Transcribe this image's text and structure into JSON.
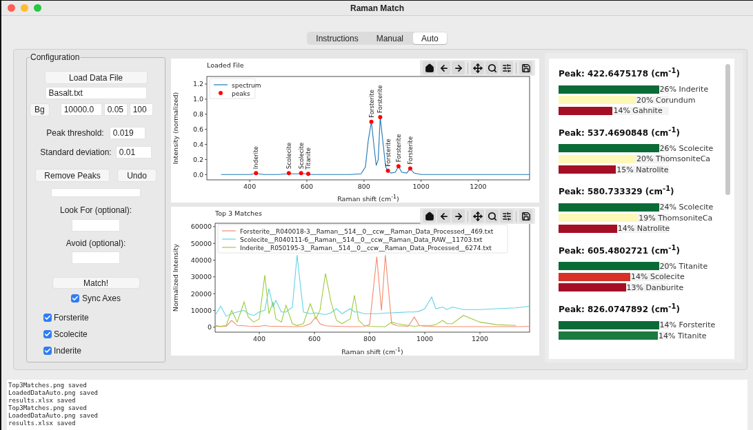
{
  "window": {
    "title": "Raman Match"
  },
  "tabs": [
    {
      "label": "Instructions",
      "selected": false
    },
    {
      "label": "Manual",
      "selected": false
    },
    {
      "label": "Auto",
      "selected": true
    }
  ],
  "configuration": {
    "title": "Configuration",
    "load_button": "Load Data File",
    "file_field": {
      "value": "Basalt.txt"
    },
    "background": {
      "button": "Bg",
      "fields": [
        "10000.0",
        "0.05",
        "100"
      ]
    },
    "peak_threshold": {
      "label": "Peak threshold:",
      "value": "0.019"
    },
    "standard_deviation": {
      "label": "Standard deviation:",
      "value": "0.01"
    },
    "remove_peaks_button": "Remove Peaks",
    "undo_button": "Undo",
    "look_for": {
      "label": "Look For (optional):"
    },
    "avoid": {
      "label": "Avoid (optional):"
    },
    "match_button": "Match!",
    "sync_axes": {
      "label": "Sync Axes",
      "checked": true
    },
    "minerals": [
      {
        "label": "Forsterite",
        "checked": true
      },
      {
        "label": "Scolecite",
        "checked": true
      },
      {
        "label": "Inderite",
        "checked": true
      }
    ]
  },
  "loaded_plot": {
    "chart_data": {
      "type": "line",
      "title": "Loaded File",
      "xlabel": "Raman shift (cm$^{-1}$)",
      "ylabel": "Intensity (normalized)",
      "x": [
        300,
        350,
        400,
        415,
        422,
        430,
        450,
        500,
        530,
        537,
        545,
        570,
        580,
        590,
        600,
        605,
        612,
        650,
        700,
        750,
        790,
        805,
        815,
        826,
        836,
        843,
        850,
        857,
        866,
        876,
        884,
        895,
        910,
        921,
        932,
        950,
        962,
        975,
        1000,
        1100,
        1200,
        1300,
        1380
      ],
      "legend": "upper left",
      "series": [
        {
          "name": "spectrum",
          "color": "#1f77b4",
          "values": [
            0,
            0,
            0,
            0.01,
            0.02,
            0.01,
            0,
            0,
            0.01,
            0.02,
            0.01,
            0.01,
            0.02,
            0.01,
            0.01,
            0.01,
            0,
            0,
            0,
            0,
            0.01,
            0.1,
            0.45,
            0.7,
            0.35,
            0.12,
            0.2,
            0.76,
            0.45,
            0.1,
            0.05,
            0.02,
            0.03,
            0.11,
            0.03,
            0.02,
            0.08,
            0.02,
            0,
            0,
            0,
            0,
            0
          ]
        },
        {
          "name": "peaks",
          "type": "scatter",
          "color": "#ff0000",
          "values": [
            null,
            null,
            null,
            null,
            0.02,
            null,
            null,
            null,
            null,
            0.02,
            null,
            null,
            0.02,
            null,
            null,
            0.01,
            null,
            null,
            null,
            null,
            null,
            null,
            null,
            0.7,
            null,
            null,
            null,
            0.76,
            null,
            null,
            0.05,
            null,
            null,
            0.11,
            null,
            null,
            0.08,
            null,
            null,
            null,
            null,
            null,
            null
          ]
        }
      ],
      "xlim": [
        250,
        1380
      ],
      "ylim": [
        -0.07,
        1.3
      ],
      "xticks": [
        400,
        600,
        800,
        1000,
        1200
      ],
      "yticks": [
        {
          "value": 0,
          "label": "0.0"
        },
        {
          "value": 0.2,
          "label": "0.2"
        },
        {
          "value": 0.4,
          "label": "0.4"
        },
        {
          "value": 0.6,
          "label": "0.6"
        },
        {
          "value": 0.8,
          "label": "0.8"
        },
        {
          "value": 1,
          "label": "1.0"
        },
        {
          "value": 1.2,
          "label": "1.2"
        }
      ],
      "annotations": [
        {
          "x": 422,
          "y": 0.02,
          "text": "Inderite"
        },
        {
          "x": 537,
          "y": 0.02,
          "text": "Scolecite"
        },
        {
          "x": 580,
          "y": 0.02,
          "text": "Scolecite"
        },
        {
          "x": 605,
          "y": 0.01,
          "text": "Titanite"
        },
        {
          "x": 826,
          "y": 0.7,
          "text": "Forsterite"
        },
        {
          "x": 857,
          "y": 0.76,
          "text": "Forsterite"
        },
        {
          "x": 884,
          "y": 0.05,
          "text": "Forsterite"
        },
        {
          "x": 921,
          "y": 0.11,
          "text": "Forsterite"
        },
        {
          "x": 962,
          "y": 0.08,
          "text": "Forsterite"
        }
      ]
    }
  },
  "matches_plot": {
    "chart_data": {
      "type": "line",
      "title": "Top 3 Matches",
      "xlabel": "Raman shift (cm$^{-1}$)",
      "ylabel": "Normalized Intensity",
      "x": [
        240,
        260,
        280,
        300,
        320,
        345,
        360,
        380,
        400,
        420,
        435,
        450,
        460,
        480,
        497,
        520,
        537,
        560,
        585,
        605,
        620,
        640,
        660,
        680,
        700,
        730,
        745,
        760,
        780,
        800,
        826,
        843,
        857,
        880,
        900,
        940,
        962,
        980,
        1000,
        1025,
        1040,
        1065,
        1080,
        1100,
        1140,
        1200,
        1260,
        1330,
        1380
      ],
      "legend": "upper left",
      "series": [
        {
          "name": "Forsterite__R040018-3__Raman__514__0__ccw__Raman_Data_Processed__469.txt",
          "color": "#f4896b",
          "values": [
            500,
            300,
            500,
            4000,
            1000,
            800,
            600,
            500,
            500,
            1000,
            600,
            500,
            500,
            400,
            400,
            300,
            300,
            500,
            2000,
            6000,
            2000,
            800,
            600,
            500,
            400,
            300,
            300,
            300,
            400,
            1500,
            42000,
            10000,
            43000,
            2000,
            800,
            500,
            6000,
            1000,
            500,
            400,
            300,
            300,
            300,
            300,
            300,
            300,
            300,
            300,
            400
          ]
        },
        {
          "name": "Scolecite__R040111-6__Raman__514__0__ccw__Raman_Data_RAW__11703.txt",
          "color": "#5fd3e3",
          "values": [
            7000,
            12500,
            6500,
            8000,
            9000,
            10000,
            8000,
            7000,
            9000,
            10000,
            23000,
            12000,
            16000,
            9000,
            9000,
            12000,
            43000,
            9000,
            8000,
            8500,
            8000,
            7500,
            8500,
            11000,
            8000,
            11000,
            9000,
            9000,
            8000,
            8000,
            8000,
            8200,
            8400,
            8500,
            8700,
            9000,
            9000,
            9500,
            11000,
            18000,
            11000,
            12000,
            10500,
            12000,
            10500,
            10500,
            11000,
            11500,
            12500
          ]
        },
        {
          "name": "Inderite__R050195-3__Raman__514__0__ccw__Raman_Data_Processed__6274.txt",
          "color": "#9ccc3c",
          "values": [
            1000,
            500,
            1000,
            10000,
            3000,
            15000,
            6000,
            3000,
            5000,
            31000,
            8000,
            15000,
            5000,
            3000,
            13000,
            2000,
            1000,
            2000,
            14000,
            5000,
            10000,
            32000,
            15000,
            4000,
            2000,
            5000,
            19000,
            4000,
            1000,
            500,
            300,
            300,
            300,
            3000,
            2000,
            1000,
            500,
            800,
            1000,
            1000,
            1500,
            4000,
            2000,
            2000,
            7000,
            3000,
            1500,
            1000,
            null
          ]
        }
      ],
      "xlim": [
        240,
        1380
      ],
      "ylim": [
        -3000,
        62000
      ],
      "xticks": [
        400,
        600,
        800,
        1000,
        1200
      ],
      "yticks": [
        0,
        10000,
        20000,
        30000,
        40000,
        50000,
        60000
      ]
    }
  },
  "results": [
    {
      "peak": "Peak: 422.6475178 (cm$^{-1}$)",
      "matches": [
        {
          "label": "26% Inderite",
          "level": 0.91,
          "color": "#0b6b36"
        },
        {
          "label": "20% Corundum",
          "level": 0.7,
          "color": "#fdf8b8"
        },
        {
          "label": "14% Gahnite",
          "level": 0.49,
          "color": "#a50f26"
        }
      ]
    },
    {
      "peak": "Peak: 537.4690848 (cm$^{-1}$)",
      "matches": [
        {
          "label": "26% Scolecite",
          "level": 0.91,
          "color": "#0b6b36"
        },
        {
          "label": "20% ThomsoniteCa",
          "level": 0.7,
          "color": "#fdf8b8"
        },
        {
          "label": "15% Natrolite",
          "level": 0.52,
          "color": "#a50f26"
        }
      ]
    },
    {
      "peak": "Peak: 580.733329 (cm$^{-1}$)",
      "matches": [
        {
          "label": "24% Scolecite",
          "level": 0.91,
          "color": "#0b6b36"
        },
        {
          "label": "19% ThomsoniteCa",
          "level": 0.72,
          "color": "#fdf8b8"
        },
        {
          "label": "14% Natrolite",
          "level": 0.53,
          "color": "#a50f26"
        }
      ]
    },
    {
      "peak": "Peak: 605.4802721 (cm$^{-1}$)",
      "matches": [
        {
          "label": "20% Titanite",
          "level": 0.91,
          "color": "#0b6b36"
        },
        {
          "label": "14% Scolecite",
          "level": 0.65,
          "color": "#d73027"
        },
        {
          "label": "13% Danburite",
          "level": 0.61,
          "color": "#a50f26"
        }
      ]
    },
    {
      "peak": "Peak: 826.0747892 (cm$^{-1}$)",
      "matches": [
        {
          "label": "14% Forsterite",
          "level": 0.91,
          "color": "#0b6b36"
        },
        {
          "label": "14% Titanite",
          "level": 0.9,
          "color": "#1a7a40"
        }
      ]
    }
  ],
  "log": [
    "Top3Matches.png saved",
    "LoadedDataAuto.png saved",
    "results.xlsx saved",
    "Top3Matches.png saved",
    "LoadedDataAuto.png saved",
    "results.xlsx saved"
  ]
}
